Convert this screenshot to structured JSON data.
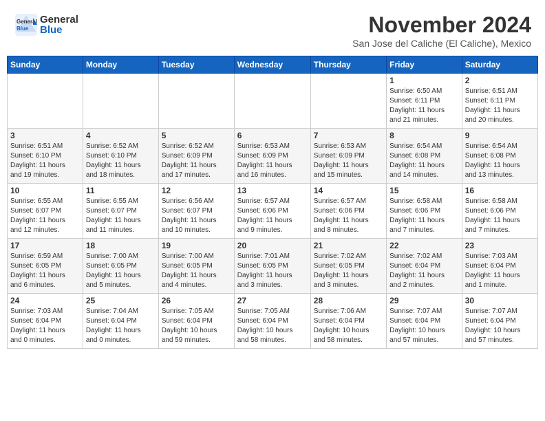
{
  "header": {
    "logo_general": "General",
    "logo_blue": "Blue",
    "month_year": "November 2024",
    "location": "San Jose del Caliche (El Caliche), Mexico"
  },
  "days_of_week": [
    "Sunday",
    "Monday",
    "Tuesday",
    "Wednesday",
    "Thursday",
    "Friday",
    "Saturday"
  ],
  "weeks": [
    {
      "row_bg": "#fff",
      "days": [
        {
          "num": "",
          "info": ""
        },
        {
          "num": "",
          "info": ""
        },
        {
          "num": "",
          "info": ""
        },
        {
          "num": "",
          "info": ""
        },
        {
          "num": "",
          "info": ""
        },
        {
          "num": "1",
          "info": "Sunrise: 6:50 AM\nSunset: 6:11 PM\nDaylight: 11 hours\nand 21 minutes."
        },
        {
          "num": "2",
          "info": "Sunrise: 6:51 AM\nSunset: 6:11 PM\nDaylight: 11 hours\nand 20 minutes."
        }
      ]
    },
    {
      "row_bg": "#f5f5f5",
      "days": [
        {
          "num": "3",
          "info": "Sunrise: 6:51 AM\nSunset: 6:10 PM\nDaylight: 11 hours\nand 19 minutes."
        },
        {
          "num": "4",
          "info": "Sunrise: 6:52 AM\nSunset: 6:10 PM\nDaylight: 11 hours\nand 18 minutes."
        },
        {
          "num": "5",
          "info": "Sunrise: 6:52 AM\nSunset: 6:09 PM\nDaylight: 11 hours\nand 17 minutes."
        },
        {
          "num": "6",
          "info": "Sunrise: 6:53 AM\nSunset: 6:09 PM\nDaylight: 11 hours\nand 16 minutes."
        },
        {
          "num": "7",
          "info": "Sunrise: 6:53 AM\nSunset: 6:09 PM\nDaylight: 11 hours\nand 15 minutes."
        },
        {
          "num": "8",
          "info": "Sunrise: 6:54 AM\nSunset: 6:08 PM\nDaylight: 11 hours\nand 14 minutes."
        },
        {
          "num": "9",
          "info": "Sunrise: 6:54 AM\nSunset: 6:08 PM\nDaylight: 11 hours\nand 13 minutes."
        }
      ]
    },
    {
      "row_bg": "#fff",
      "days": [
        {
          "num": "10",
          "info": "Sunrise: 6:55 AM\nSunset: 6:07 PM\nDaylight: 11 hours\nand 12 minutes."
        },
        {
          "num": "11",
          "info": "Sunrise: 6:55 AM\nSunset: 6:07 PM\nDaylight: 11 hours\nand 11 minutes."
        },
        {
          "num": "12",
          "info": "Sunrise: 6:56 AM\nSunset: 6:07 PM\nDaylight: 11 hours\nand 10 minutes."
        },
        {
          "num": "13",
          "info": "Sunrise: 6:57 AM\nSunset: 6:06 PM\nDaylight: 11 hours\nand 9 minutes."
        },
        {
          "num": "14",
          "info": "Sunrise: 6:57 AM\nSunset: 6:06 PM\nDaylight: 11 hours\nand 8 minutes."
        },
        {
          "num": "15",
          "info": "Sunrise: 6:58 AM\nSunset: 6:06 PM\nDaylight: 11 hours\nand 7 minutes."
        },
        {
          "num": "16",
          "info": "Sunrise: 6:58 AM\nSunset: 6:06 PM\nDaylight: 11 hours\nand 7 minutes."
        }
      ]
    },
    {
      "row_bg": "#f5f5f5",
      "days": [
        {
          "num": "17",
          "info": "Sunrise: 6:59 AM\nSunset: 6:05 PM\nDaylight: 11 hours\nand 6 minutes."
        },
        {
          "num": "18",
          "info": "Sunrise: 7:00 AM\nSunset: 6:05 PM\nDaylight: 11 hours\nand 5 minutes."
        },
        {
          "num": "19",
          "info": "Sunrise: 7:00 AM\nSunset: 6:05 PM\nDaylight: 11 hours\nand 4 minutes."
        },
        {
          "num": "20",
          "info": "Sunrise: 7:01 AM\nSunset: 6:05 PM\nDaylight: 11 hours\nand 3 minutes."
        },
        {
          "num": "21",
          "info": "Sunrise: 7:02 AM\nSunset: 6:05 PM\nDaylight: 11 hours\nand 3 minutes."
        },
        {
          "num": "22",
          "info": "Sunrise: 7:02 AM\nSunset: 6:04 PM\nDaylight: 11 hours\nand 2 minutes."
        },
        {
          "num": "23",
          "info": "Sunrise: 7:03 AM\nSunset: 6:04 PM\nDaylight: 11 hours\nand 1 minute."
        }
      ]
    },
    {
      "row_bg": "#fff",
      "days": [
        {
          "num": "24",
          "info": "Sunrise: 7:03 AM\nSunset: 6:04 PM\nDaylight: 11 hours\nand 0 minutes."
        },
        {
          "num": "25",
          "info": "Sunrise: 7:04 AM\nSunset: 6:04 PM\nDaylight: 11 hours\nand 0 minutes."
        },
        {
          "num": "26",
          "info": "Sunrise: 7:05 AM\nSunset: 6:04 PM\nDaylight: 10 hours\nand 59 minutes."
        },
        {
          "num": "27",
          "info": "Sunrise: 7:05 AM\nSunset: 6:04 PM\nDaylight: 10 hours\nand 58 minutes."
        },
        {
          "num": "28",
          "info": "Sunrise: 7:06 AM\nSunset: 6:04 PM\nDaylight: 10 hours\nand 58 minutes."
        },
        {
          "num": "29",
          "info": "Sunrise: 7:07 AM\nSunset: 6:04 PM\nDaylight: 10 hours\nand 57 minutes."
        },
        {
          "num": "30",
          "info": "Sunrise: 7:07 AM\nSunset: 6:04 PM\nDaylight: 10 hours\nand 57 minutes."
        }
      ]
    }
  ]
}
